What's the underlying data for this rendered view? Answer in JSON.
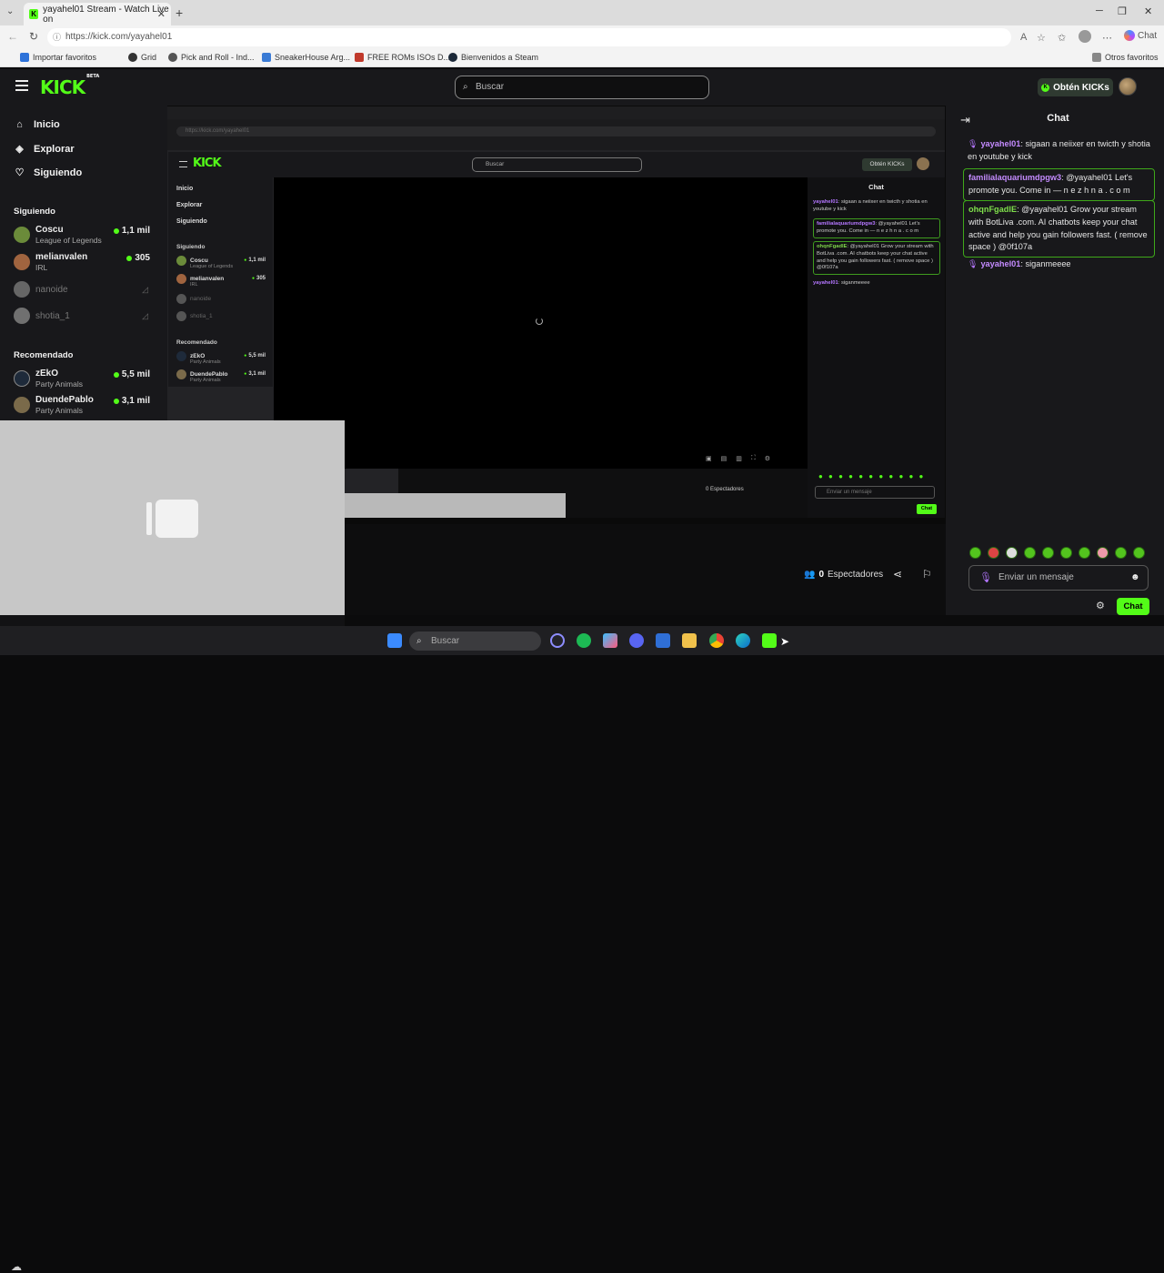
{
  "browser": {
    "tab_title": "yayahel01 Stream - Watch Live on",
    "url": "https://kick.com/yayahel01",
    "copilot_label": "Chat",
    "bookmarks": [
      {
        "label": "Importar favoritos",
        "color": "#2d72d9"
      },
      {
        "label": "Grid",
        "color": "#333333"
      },
      {
        "label": "Pick and Roll - Ind...",
        "color": "#555555"
      },
      {
        "label": "SneakerHouse Arg...",
        "color": "#3a7bd5"
      },
      {
        "label": "FREE ROMs ISOs D...",
        "color": "#c0392b"
      },
      {
        "label": "Bienvenidos a Steam",
        "color": "#1b2838"
      }
    ],
    "other_bookmarks": "Otros favoritos"
  },
  "header": {
    "logo": "KICK",
    "logo_badge": "BETA",
    "search_placeholder": "Buscar",
    "kicks_button": "Obtén KICKs"
  },
  "sidebar": {
    "nav": [
      {
        "label": "Inicio",
        "icon": "home-icon"
      },
      {
        "label": "Explorar",
        "icon": "compass-icon"
      },
      {
        "label": "Siguiendo",
        "icon": "heart-icon"
      }
    ],
    "following_title": "Siguiendo",
    "following": [
      {
        "name": "Coscu",
        "category": "League of Legends",
        "viewers": "1,1 mil",
        "online": true
      },
      {
        "name": "melianvalen",
        "category": "IRL",
        "viewers": "305",
        "online": true
      },
      {
        "name": "nanoide",
        "category": "",
        "viewers": "",
        "online": false
      },
      {
        "name": "shotia_1",
        "category": "",
        "viewers": "",
        "online": false
      }
    ],
    "recommended_title": "Recomendado",
    "recommended": [
      {
        "name": "zEkO",
        "category": "Party Animals",
        "viewers": "5,5 mil"
      },
      {
        "name": "DuendePablo",
        "category": "Party Animals",
        "viewers": "3,1 mil"
      }
    ]
  },
  "stream": {
    "viewers_count": "0",
    "viewers_label": "Espectadores"
  },
  "chat": {
    "title": "Chat",
    "messages": [
      {
        "user": "yayahel01",
        "text": ": sigaan a neiixer en twicth y shotia en youtube y kick",
        "highlight": false,
        "user_color": "purple"
      },
      {
        "user": "familialaquariumdpgw3",
        "text": ": @yayahel01 Let's promote you. Come in — n e z h n a . c o m",
        "highlight": true,
        "user_color": "purple"
      },
      {
        "user": "ohqnFgadlE",
        "text": ": @yayahel01 Grow your stream with BotLiva .com. AI chatbots keep your chat active and help you gain followers fast. ( remove space ) @0f107a",
        "highlight": true,
        "user_color": "green"
      },
      {
        "user": "yayahel01",
        "text": ": siganmeeee",
        "highlight": false,
        "user_color": "purple"
      }
    ],
    "input_placeholder": "Enviar un mensaje",
    "send_label": "Chat"
  },
  "taskbar": {
    "search_placeholder": "Buscar"
  }
}
